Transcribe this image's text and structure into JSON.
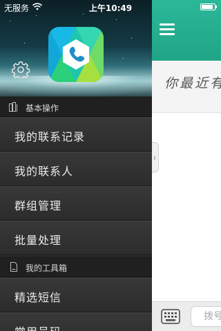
{
  "status_bar": {
    "carrier": "无服务",
    "time": "上午10:49"
  },
  "drawer": {
    "sections": [
      {
        "title": "基本操作",
        "items": [
          "我的联系记录",
          "我的联系人",
          "群组管理",
          "批量处理"
        ]
      },
      {
        "title": "我的工具箱",
        "items": [
          "精选短信",
          "常用号码"
        ]
      }
    ]
  },
  "main": {
    "recent_text": "你最近有",
    "dial_placeholder": "拨号"
  },
  "colors": {
    "nav_bar": "#25ad8f",
    "drawer_bg": "#2b2b2b",
    "section_bg": "#202020"
  },
  "icons": [
    "wifi-icon",
    "battery-icon",
    "app-logo-icon",
    "gear-icon",
    "document-stack-icon",
    "document-icon",
    "hamburger-menu-icon",
    "keypad-icon"
  ]
}
